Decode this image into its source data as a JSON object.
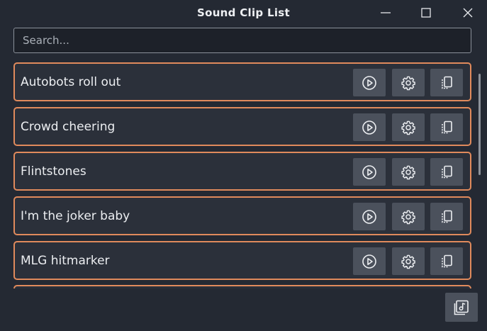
{
  "window": {
    "title": "Sound Clip List",
    "controls": [
      "minimize-icon",
      "maximize-icon",
      "close-icon"
    ]
  },
  "search": {
    "placeholder": "Search...",
    "value": ""
  },
  "clips": [
    {
      "label": "Autobots roll out"
    },
    {
      "label": "Crowd cheering"
    },
    {
      "label": "Flintstones"
    },
    {
      "label": "I'm the joker baby"
    },
    {
      "label": "MLG hitmarker"
    },
    {
      "label": ""
    }
  ],
  "row_actions": [
    "play-icon",
    "gear-icon",
    "copy-icon"
  ],
  "footer": {
    "add_button_icon": "add-music-icon"
  },
  "colors": {
    "background": "#242933",
    "row_background": "#2b303a",
    "row_border": "#e08a5c",
    "button": "#4b515c",
    "text": "#eceef1"
  }
}
